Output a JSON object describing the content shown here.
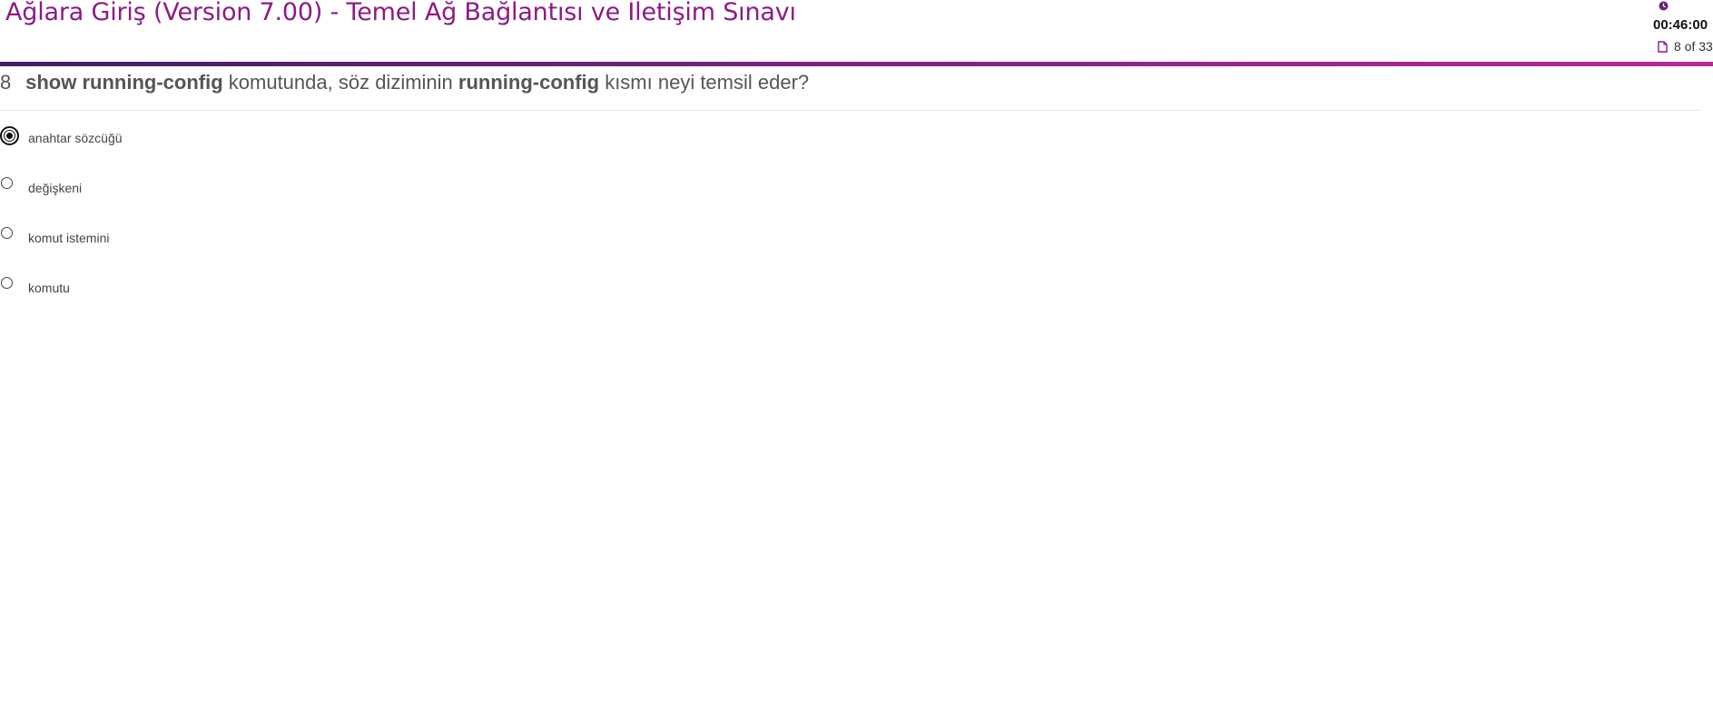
{
  "header": {
    "title": "Ağlara Giriş (Version 7.00) - Temel Ağ Bağlantısı ve İletişim Sınavı",
    "timer": "00:46:00",
    "progress": "8 of 33",
    "clock_icon": "clock-icon",
    "doc_icon": "document-icon",
    "accent_color": "#8c1a87"
  },
  "question": {
    "number": "8",
    "parts": [
      {
        "text": "show running-config",
        "bold": true
      },
      {
        "text": " komutunda, söz diziminin ",
        "bold": false
      },
      {
        "text": "running-config",
        "bold": true
      },
      {
        "text": " kısmı neyi temsil eder?",
        "bold": false
      }
    ]
  },
  "options": [
    {
      "label": "anahtar sözcüğü",
      "selected": true
    },
    {
      "label": "değişkeni",
      "selected": false
    },
    {
      "label": "komut istemini",
      "selected": false
    },
    {
      "label": "komutu",
      "selected": false
    }
  ]
}
